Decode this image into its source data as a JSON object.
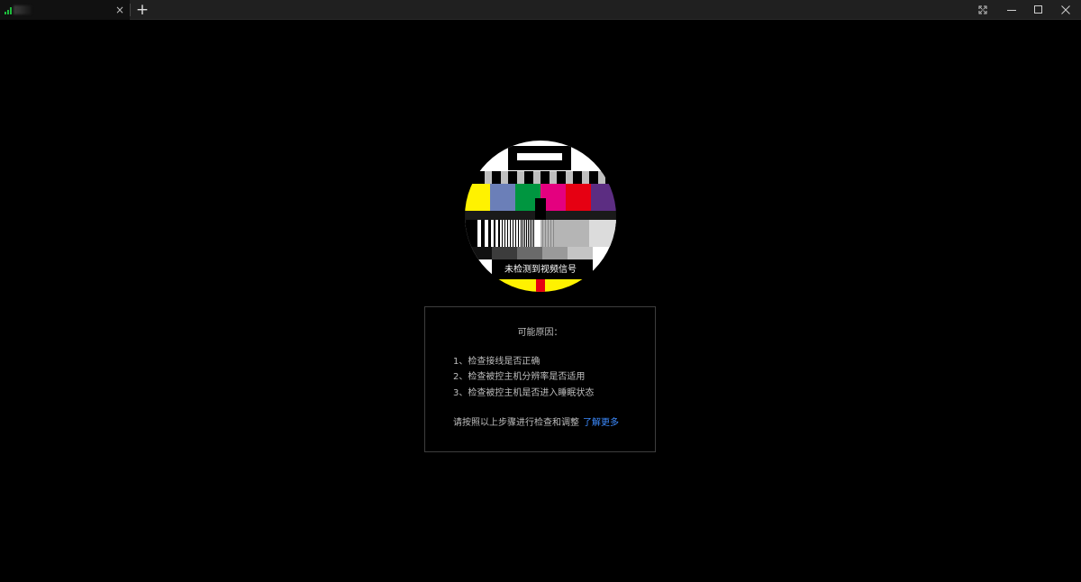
{
  "titlebar": {
    "tab": {
      "title": "",
      "icon": "signal-bars-icon",
      "close_label": "×"
    },
    "new_tab_label": "+",
    "controls": [
      "fullscreen-icon",
      "minimize-icon",
      "maximize-icon",
      "close-icon"
    ]
  },
  "main": {
    "no_signal_text": "未检测到视频信号",
    "reasons": {
      "title": "可能原因：",
      "items": [
        {
          "num": "1、",
          "text": "检查接线是否正确"
        },
        {
          "num": "2、",
          "text": "检查被控主机分辨率是否适用"
        },
        {
          "num": "3、",
          "text": "检查被控主机是否进入睡眠状态"
        }
      ],
      "hint": "请按照以上步骤进行检查和调整",
      "learn_more": "了解更多"
    }
  },
  "colors": {
    "background": "#000000",
    "titlebar": "#202020",
    "link": "#3d8bff",
    "signal": "#1dbb3c",
    "test_card_bars": [
      "#fff200",
      "#6b7fb8",
      "#009640",
      "#e4007f",
      "#e60012",
      "#5c2d82"
    ]
  }
}
